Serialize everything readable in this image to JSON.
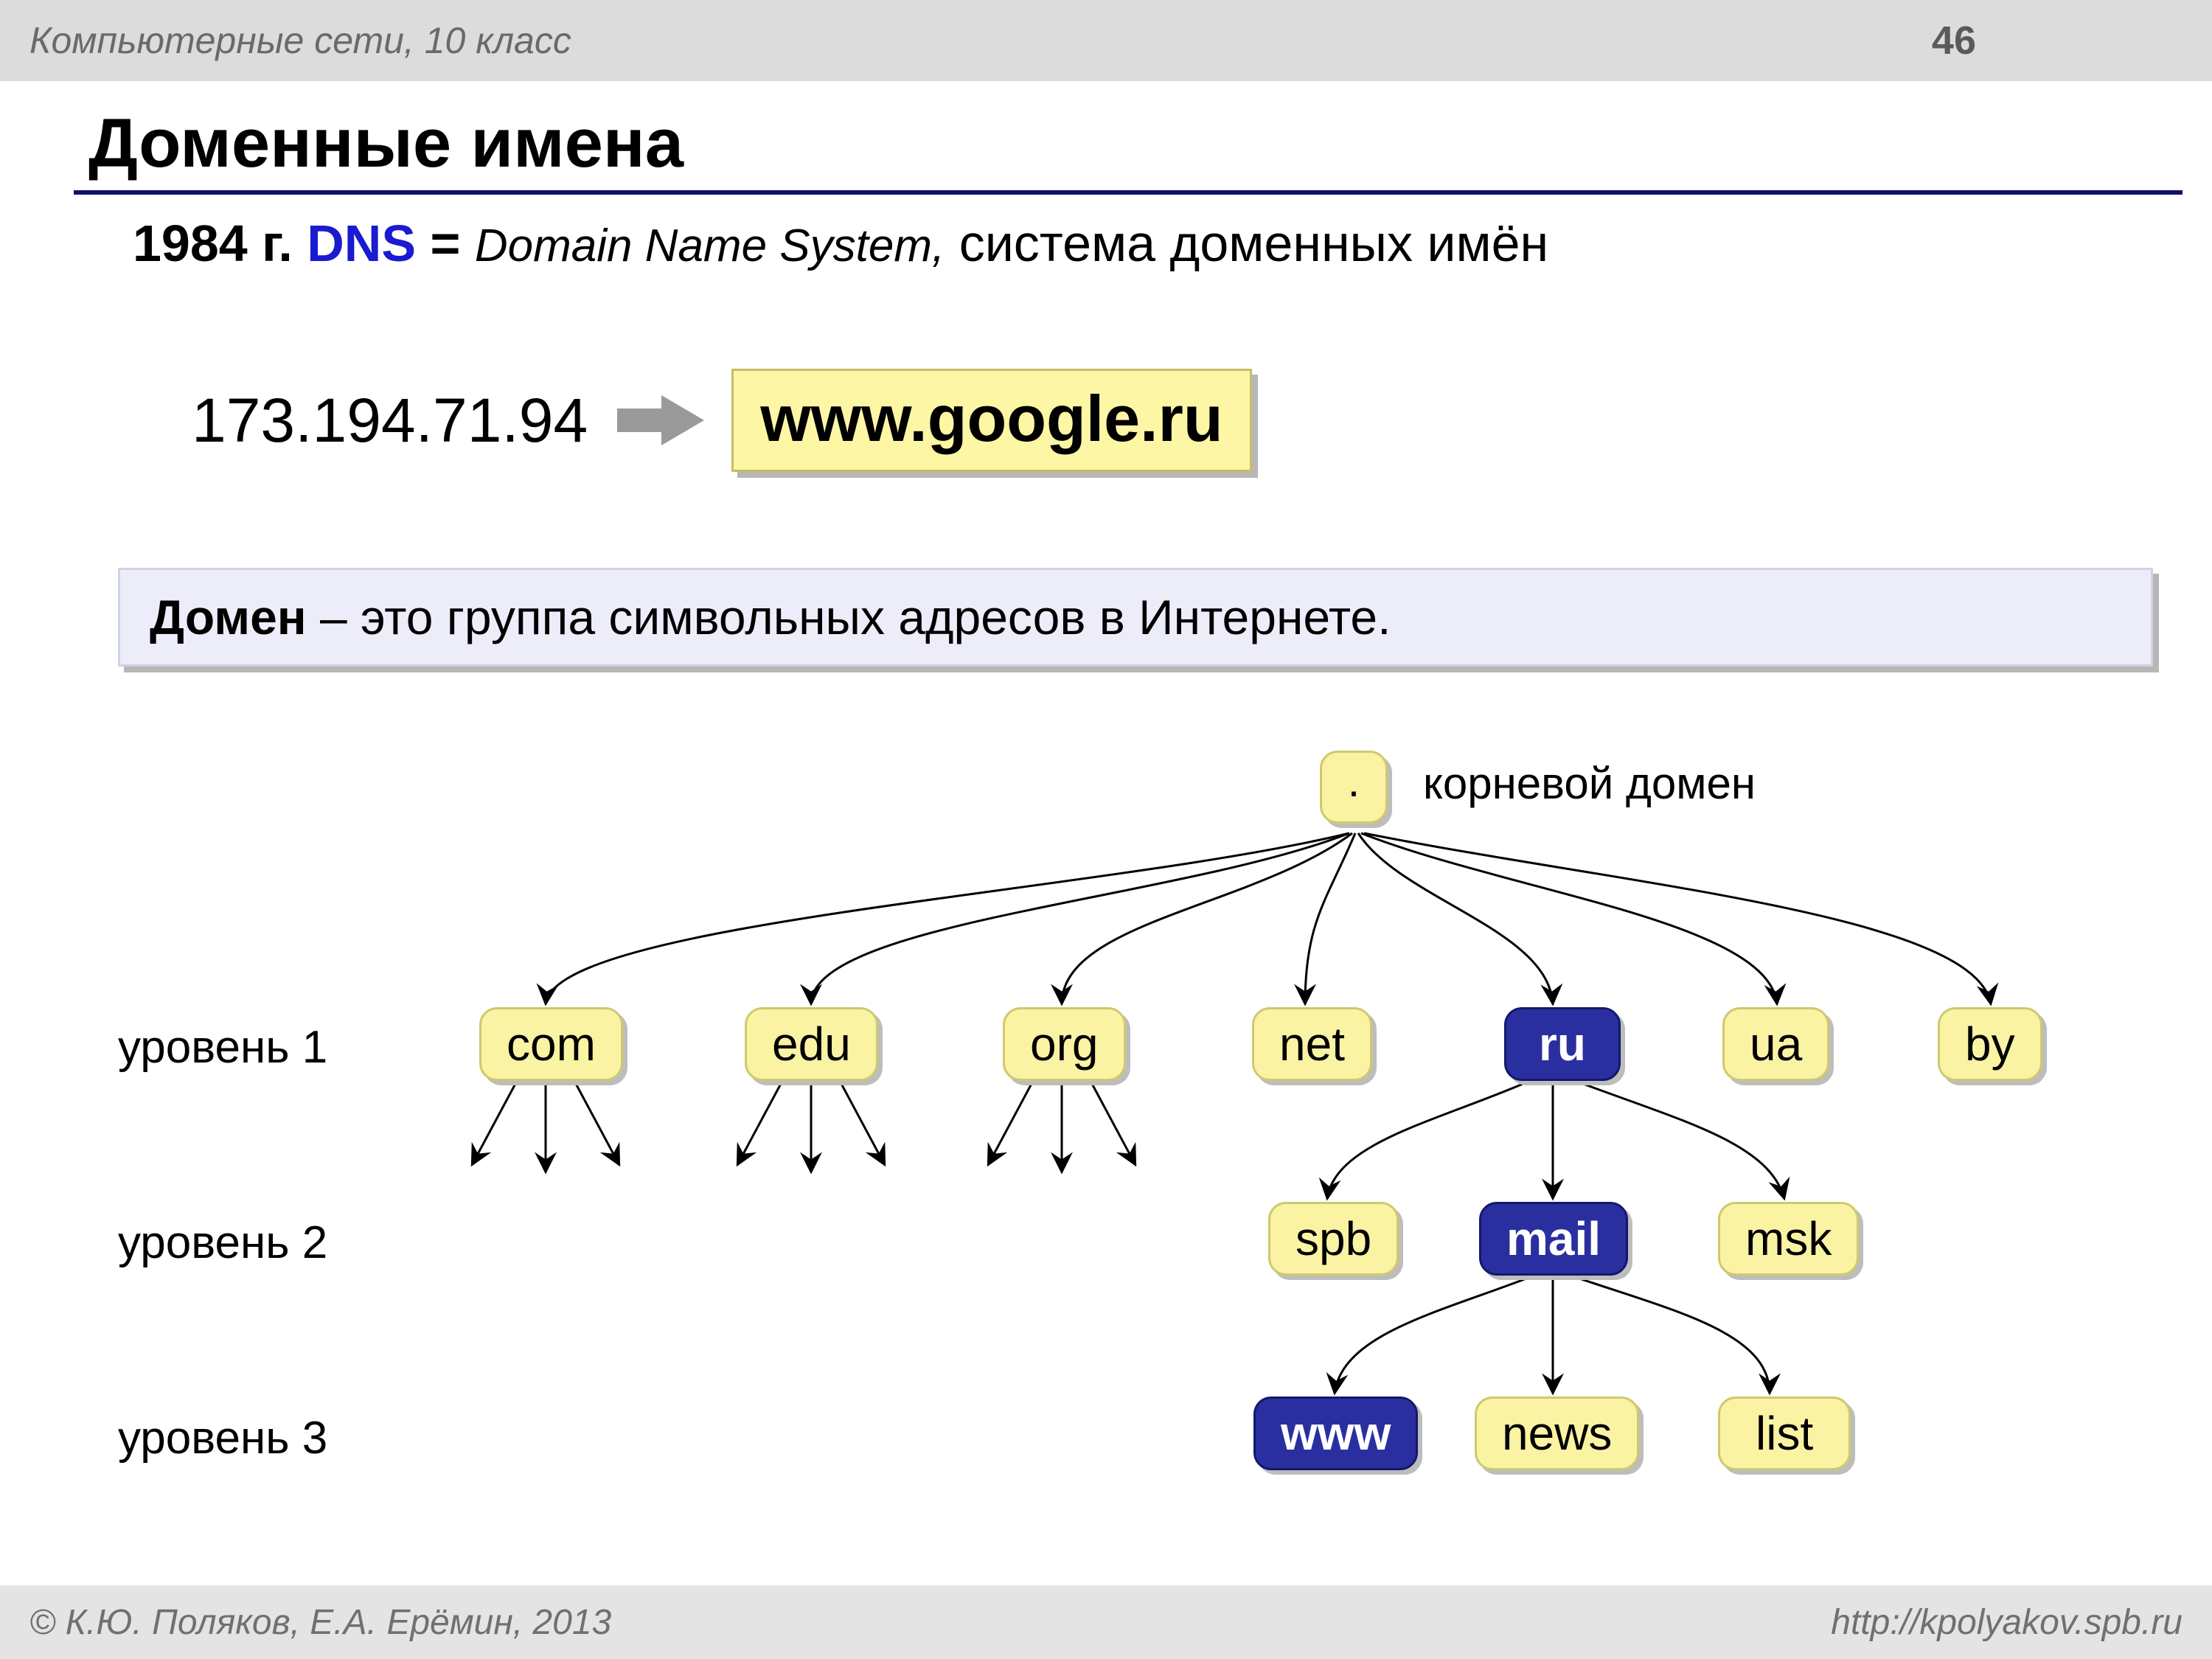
{
  "header": {
    "topic": "Компьютерные сети, 10 класс",
    "page": "46"
  },
  "footer": {
    "copyright": "© К.Ю. Поляков, Е.А. Ерёмин, 2013",
    "url": "http://kpolyakov.spb.ru"
  },
  "title": "Доменные имена",
  "line1": {
    "year": "1984 г.",
    "dns": "DNS",
    "eq": " = ",
    "full_en": "Domain Name System,",
    "full_ru": " система доменных имён"
  },
  "example": {
    "ip": "173.194.71.94",
    "host": "www.google.ru"
  },
  "definition": {
    "term": "Домен",
    "text": " – это группа символьных адресов в Интернете."
  },
  "tree": {
    "root_symbol": ".",
    "root_label": "корневой домен",
    "level_labels": [
      "уровень 1",
      "уровень 2",
      "уровень 3"
    ],
    "level1": [
      "com",
      "edu",
      "org",
      "net",
      "ru",
      "ua",
      "by"
    ],
    "level1_selected": "ru",
    "level2": [
      "spb",
      "mail",
      "msk"
    ],
    "level2_selected": "mail",
    "level3": [
      "www",
      "news",
      "list"
    ],
    "level3_selected": "www"
  }
}
